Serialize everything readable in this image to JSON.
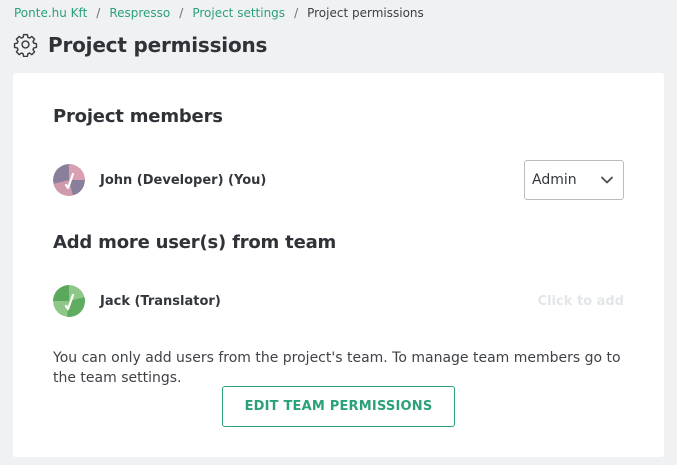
{
  "breadcrumb": {
    "items": [
      "Ponte.hu Kft",
      "Respresso",
      "Project settings"
    ],
    "separator": "/",
    "current": "Project permissions"
  },
  "page": {
    "title": "Project permissions",
    "icon": "gear-icon"
  },
  "members": {
    "title": "Project members",
    "list": [
      {
        "name": "John (Developer) (You)",
        "role": "Admin",
        "avatar_colors": [
          "#8a7f9a",
          "#d8a0b0"
        ]
      }
    ]
  },
  "add_users": {
    "title": "Add more user(s) from team",
    "list": [
      {
        "name": "Jack (Translator)",
        "action": "Click to add",
        "avatar_colors": [
          "#8fc78a",
          "#5aa85c"
        ]
      }
    ],
    "info": "You can only add users from the project's team. To manage team members go to the team settings.",
    "button_label": "EDIT TEAM PERMISSIONS"
  },
  "colors": {
    "accent": "#2aa17b",
    "background": "#f0f1f3",
    "card": "#ffffff"
  }
}
